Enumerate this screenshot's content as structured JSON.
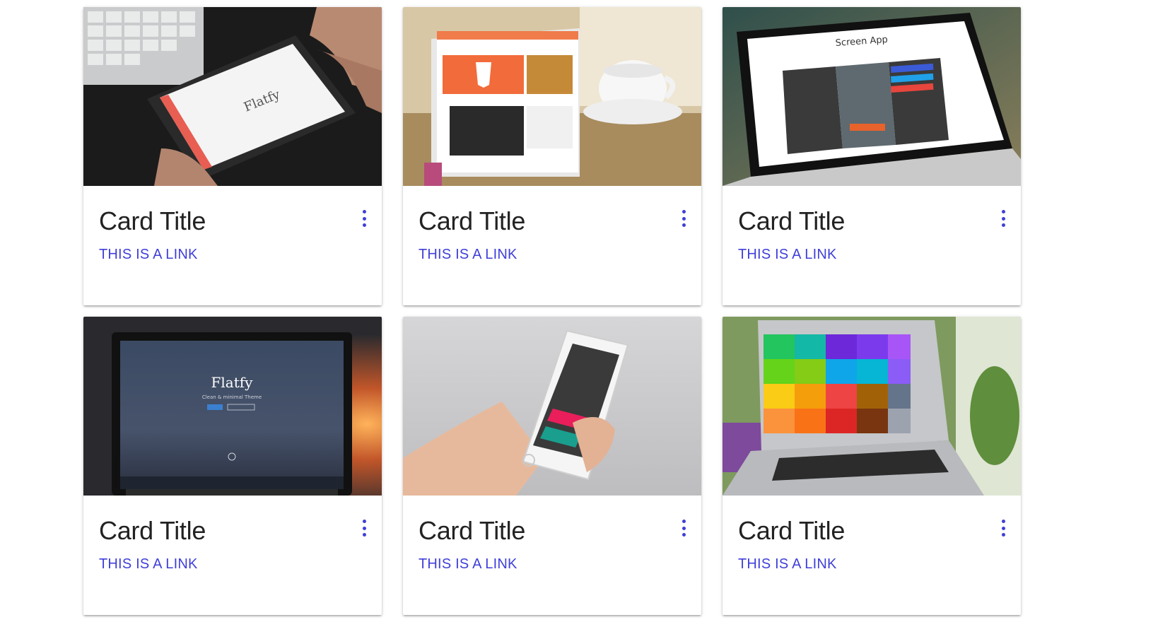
{
  "accent_color": "#3f3fd9",
  "cards": [
    {
      "title": "Card Title",
      "link": "THIS IS A LINK",
      "menu_icon": "more-vert-icon",
      "image": "tablet-in-hands-photo"
    },
    {
      "title": "Card Title",
      "link": "THIS IS A LINK",
      "menu_icon": "more-vert-icon",
      "image": "tablet-and-coffee-cup-photo"
    },
    {
      "title": "Card Title",
      "link": "THIS IS A LINK",
      "menu_icon": "more-vert-icon",
      "image": "laptop-screen-app-photo"
    },
    {
      "title": "Card Title",
      "link": "THIS IS A LINK",
      "menu_icon": "more-vert-icon",
      "image": "laptop-sunset-photo"
    },
    {
      "title": "Card Title",
      "link": "THIS IS A LINK",
      "menu_icon": "more-vert-icon",
      "image": "phone-in-hand-photo"
    },
    {
      "title": "Card Title",
      "link": "THIS IS A LINK",
      "menu_icon": "more-vert-icon",
      "image": "laptop-colorful-grid-photo"
    }
  ],
  "image_text": {
    "flatfy": "Flatfy",
    "screen_app": "Screen App",
    "flatfy_sub": "Clean & minimal Theme"
  }
}
